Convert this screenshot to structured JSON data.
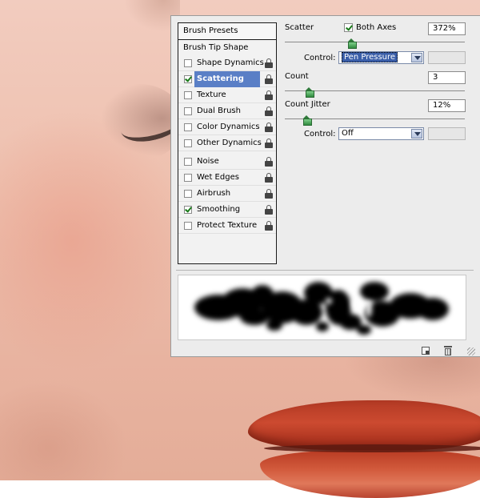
{
  "brush_panel": {
    "presets_label": "Brush Presets",
    "tip_shape_label": "Brush Tip Shape",
    "options": [
      {
        "label": "Shape Dynamics",
        "checked": false,
        "selected": false
      },
      {
        "label": "Scattering",
        "checked": true,
        "selected": true
      },
      {
        "label": "Texture",
        "checked": false,
        "selected": false
      },
      {
        "label": "Dual Brush",
        "checked": false,
        "selected": false
      },
      {
        "label": "Color Dynamics",
        "checked": false,
        "selected": false
      },
      {
        "label": "Other Dynamics",
        "checked": false,
        "selected": false
      },
      {
        "label": "Noise",
        "checked": false,
        "selected": false
      },
      {
        "label": "Wet Edges",
        "checked": false,
        "selected": false
      },
      {
        "label": "Airbrush",
        "checked": false,
        "selected": false
      },
      {
        "label": "Smoothing",
        "checked": true,
        "selected": false
      },
      {
        "label": "Protect Texture",
        "checked": false,
        "selected": false
      }
    ],
    "scatter": {
      "label": "Scatter",
      "both_axes_label": "Both Axes",
      "both_axes_checked": true,
      "value": "372%",
      "control_label": "Control:",
      "control_value": "Pen Pressure"
    },
    "count": {
      "label": "Count",
      "value": "3"
    },
    "count_jitter": {
      "label": "Count Jitter",
      "value": "12%",
      "control_label": "Control:",
      "control_value": "Off"
    }
  },
  "colors": {
    "selected_bg": "#5a7fc6",
    "check_green": "#1a7a1a",
    "lip_red": "#c8442c"
  }
}
